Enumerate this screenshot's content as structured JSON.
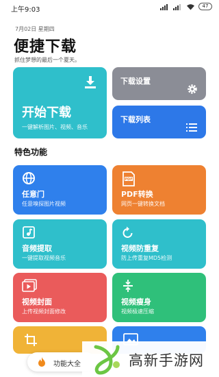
{
  "status_bar": {
    "time": "上午9:03",
    "battery": "47"
  },
  "header": {
    "date": "7月02日 星期四",
    "title": "便捷下载",
    "subtitle": "抓住梦想的最后一个夏天。"
  },
  "top_cards": {
    "start": {
      "title": "开始下载",
      "desc": "一键解析图片、视频、音乐",
      "icon": "download-icon"
    },
    "settings": {
      "title": "下载设置",
      "icon": "gear-icon"
    },
    "list": {
      "title": "下载列表",
      "icon": "list-icon"
    }
  },
  "features": {
    "section_title": "特色功能",
    "items": [
      {
        "title": "任意门",
        "desc": "任意嗅探图片视频",
        "icon": "globe-icon",
        "color": "#2f80ec"
      },
      {
        "title": "PDF转换",
        "desc": "网页一键转换文档",
        "icon": "pdf-icon",
        "color": "#ee8131"
      },
      {
        "title": "音频提取",
        "desc": "一键提取视频音乐",
        "icon": "music-icon",
        "color": "#2fbfcb"
      },
      {
        "title": "视频防重复",
        "desc": "防上传重复MD5检测",
        "icon": "refresh-icon",
        "color": "#2fbfcb"
      },
      {
        "title": "视频封面",
        "desc": "上传视频封面修改",
        "icon": "video-play-icon",
        "color": "#ea5b5b"
      },
      {
        "title": "视频瘦身",
        "desc": "视频极速压缩",
        "icon": "compress-icon",
        "color": "#2fc07a"
      },
      {
        "title": "",
        "desc": "",
        "icon": "crop-icon",
        "color": "#f0b337"
      },
      {
        "title": "",
        "desc": "",
        "icon": "image-icon",
        "color": "#2f80ec"
      }
    ]
  },
  "bottom": {
    "button_label": "功能大全",
    "icon": "flame-icon"
  },
  "watermark": {
    "text": "高新手游网"
  }
}
